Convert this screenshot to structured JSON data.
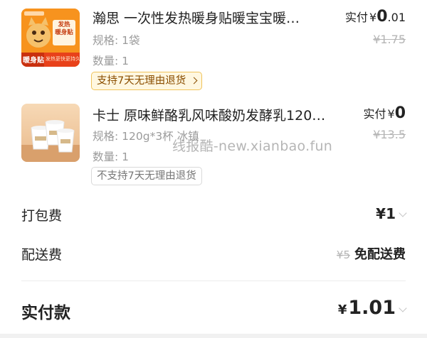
{
  "items": [
    {
      "title": "瀚思 一次性发热暖身贴暖宝宝暖…",
      "spec": "规格: 1袋",
      "qty": "数量: 1",
      "paid_label": "实付",
      "currency": "¥",
      "paid_int": "0",
      "paid_dec": ".01",
      "orig_price": "¥1.75",
      "tag": "支持7天无理由退货",
      "thumb_badge": "暖身贴",
      "thumb_box_text": "发热\n暖身贴",
      "thumb_strip_text": "发热更快更持久"
    },
    {
      "title": "卡士 原味鲜酪乳风味酸奶发酵乳120…",
      "spec": "规格: 120g*3杯 冰镇",
      "qty": "数量: 1",
      "paid_label": "实付",
      "currency": "¥",
      "paid_int": "0",
      "paid_dec": "",
      "orig_price": "¥13.5",
      "tag": "不支持7天无理由退货"
    }
  ],
  "watermark": "线报酷-new.xianbao.fun",
  "packing": {
    "label": "打包费",
    "value": "¥1"
  },
  "delivery": {
    "label": "配送费",
    "orig": "¥5",
    "value": "免配送费"
  },
  "total": {
    "label": "实付款",
    "currency": "¥",
    "value": "1.01"
  },
  "colors": {
    "accent": "#ee5a24",
    "tag_bg": "#fff7e0",
    "tag_border": "#f0c35a",
    "tag_text": "#8a4e00"
  }
}
